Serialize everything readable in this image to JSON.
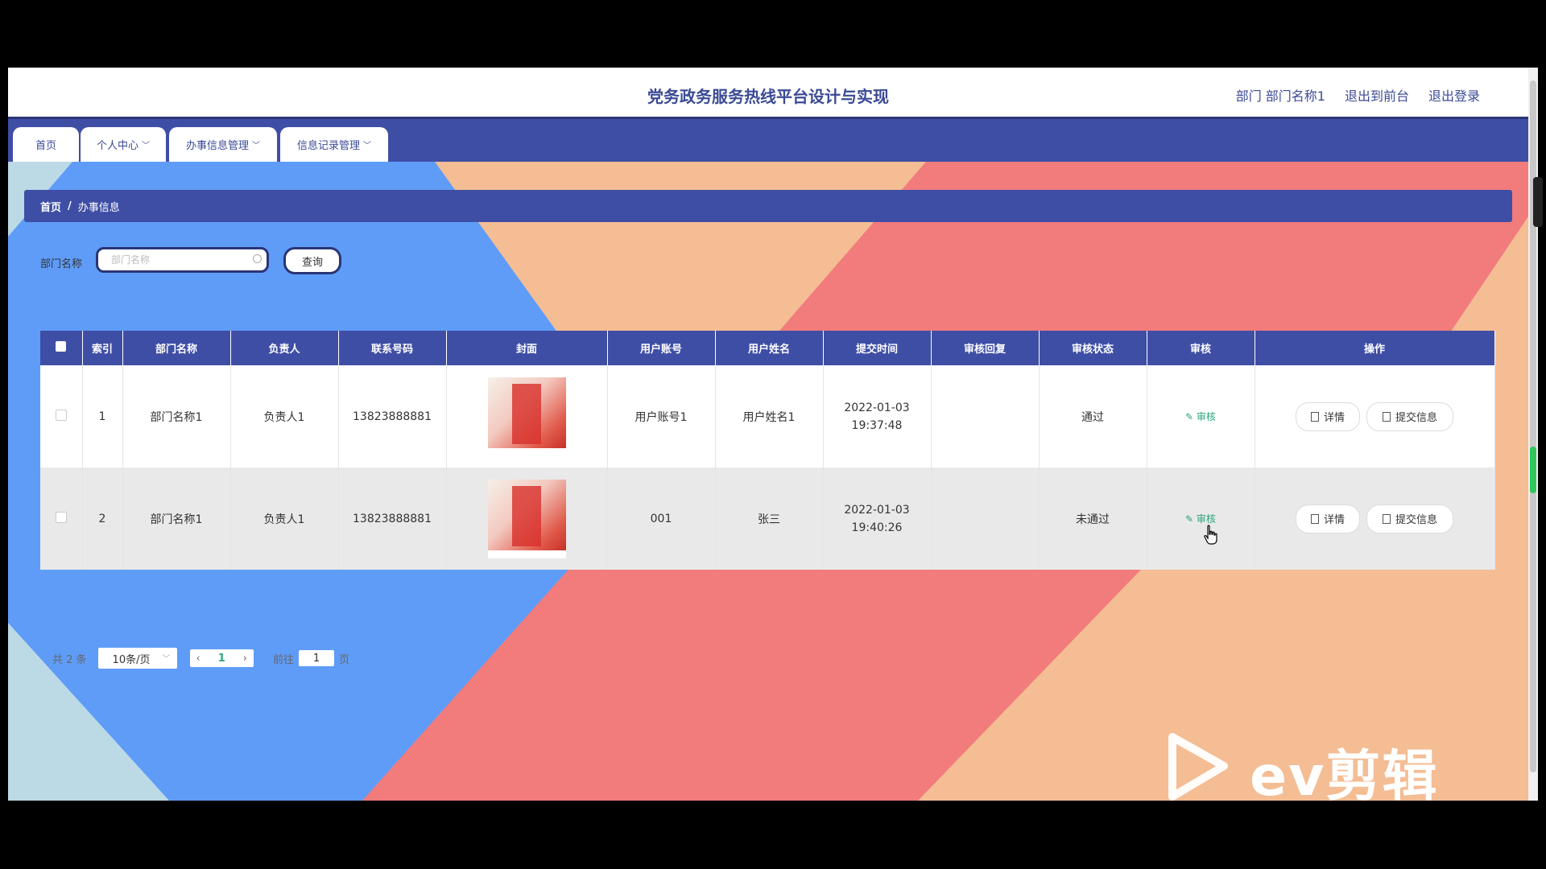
{
  "header": {
    "title": "党务政务服务热线平台设计与实现",
    "dept_label": "部门 部门名称1",
    "to_front": "退出到前台",
    "logout": "退出登录"
  },
  "nav": {
    "items": [
      {
        "label": "首页"
      },
      {
        "label": "个人中心"
      },
      {
        "label": "办事信息管理"
      },
      {
        "label": "信息记录管理"
      }
    ]
  },
  "breadcrumb": {
    "home": "首页",
    "sep": "/",
    "current": "办事信息"
  },
  "search": {
    "label": "部门名称",
    "placeholder": "部门名称",
    "button": "查询"
  },
  "table": {
    "columns": [
      "索引",
      "部门名称",
      "负责人",
      "联系号码",
      "封面",
      "用户账号",
      "用户姓名",
      "提交时间",
      "审核回复",
      "审核状态",
      "审核",
      "操作"
    ],
    "rows": [
      {
        "index": "1",
        "dept": "部门名称1",
        "leader": "负责人1",
        "phone": "13823888881",
        "account": "用户账号1",
        "name": "用户姓名1",
        "time": "2022-01-03 19:37:48",
        "reply": "",
        "status": "通过",
        "audit": "审核",
        "detail": "详情",
        "submit": "提交信息"
      },
      {
        "index": "2",
        "dept": "部门名称1",
        "leader": "负责人1",
        "phone": "13823888881",
        "account": "001",
        "name": "张三",
        "time": "2022-01-03 19:40:26",
        "reply": "",
        "status": "未通过",
        "audit": "审核",
        "detail": "详情",
        "submit": "提交信息"
      }
    ]
  },
  "pagination": {
    "total": "共 2 条",
    "page_size": "10条/页",
    "current_page": "1",
    "goto_prefix": "前往",
    "goto_value": "1",
    "goto_suffix": "页"
  },
  "watermark": {
    "text": "ev剪辑"
  },
  "colors": {
    "primary": "#3f4ea5",
    "accent": "#2ba57b",
    "bg_blue": "#5f9cf8",
    "bg_salmon": "#f27b7b",
    "bg_peach": "#f4bd94"
  }
}
